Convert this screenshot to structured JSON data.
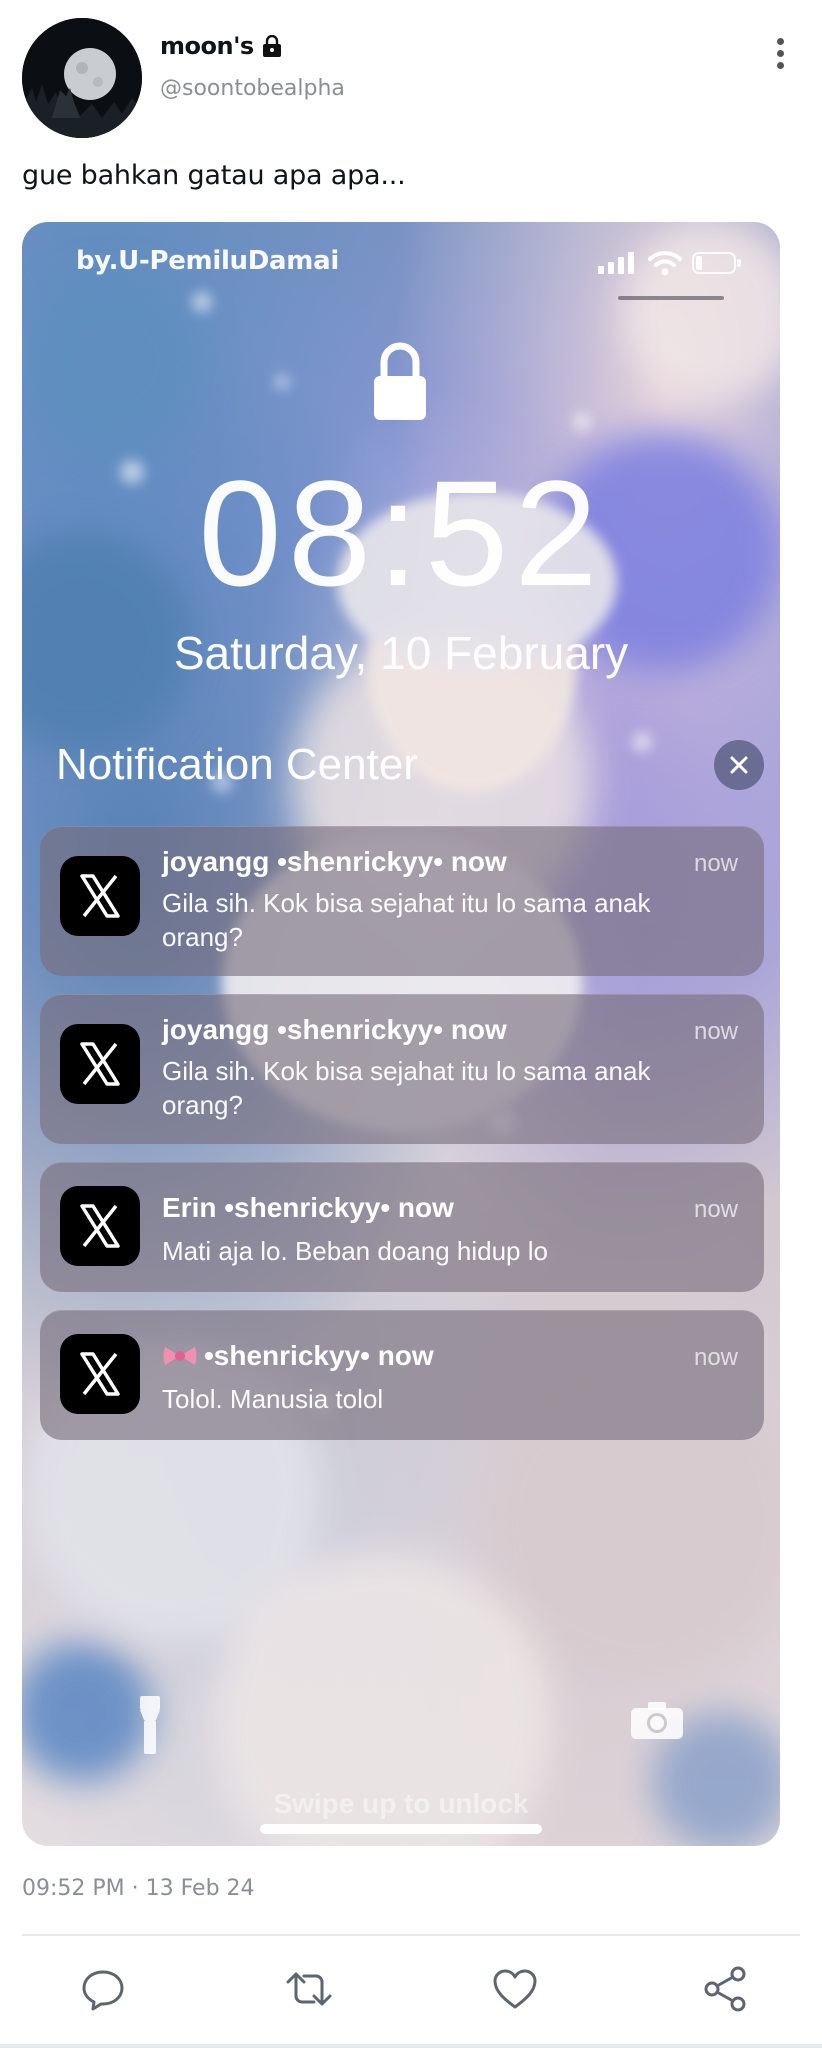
{
  "tweet": {
    "display_name": "moon's",
    "handle": "@soontobealpha",
    "text": "gue bahkan gatau apa apa...",
    "timestamp": "09:52 PM · 13 Feb 24"
  },
  "lockscreen": {
    "watermark": "by.U-PemiluDamai",
    "time": "08:52",
    "date": "Saturday, 10 February",
    "notification_center_title": "Notification Center",
    "swipe_hint": "Swipe up to unlock",
    "notifications": [
      {
        "app_icon": "x-logo-icon",
        "title": "joyangg •shenrickyy• now",
        "time": "now",
        "body": "Gila sih. Kok bisa sejahat itu lo sama anak orang?"
      },
      {
        "app_icon": "x-logo-icon",
        "title": "joyangg •shenrickyy• now",
        "time": "now",
        "body": "Gila sih. Kok bisa sejahat itu lo sama anak orang?"
      },
      {
        "app_icon": "x-logo-icon",
        "title": "Erin •shenrickyy• now",
        "time": "now",
        "body": "Mati aja lo. Beban doang hidup lo"
      },
      {
        "app_icon": "x-logo-icon",
        "title_emoji": "ribbon-emoji",
        "title": "•shenrickyy• now",
        "time": "now",
        "body": "Tolol. Manusia tolol"
      }
    ]
  },
  "actions": [
    "reply-icon",
    "retweet-icon",
    "like-icon",
    "share-icon"
  ],
  "colors": {
    "text": "#0f1419",
    "muted": "#8a8f95",
    "divider": "#e6e8ea"
  }
}
